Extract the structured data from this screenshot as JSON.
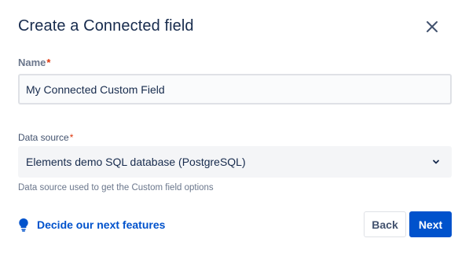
{
  "dialog": {
    "title": "Create a Connected field",
    "close_icon": "close-icon"
  },
  "name_field": {
    "label": "Name",
    "required_mark": "*",
    "value": "My Connected Custom Field"
  },
  "data_source": {
    "label": "Data source",
    "required_mark": "*",
    "selected": "Elements demo SQL database (PostgreSQL)",
    "helper": "Data source used to get the Custom field options",
    "chevron_icon": "chevron-down-icon"
  },
  "footer": {
    "feedback_icon": "lightbulb-icon",
    "feedback_link": "Decide our next features",
    "back_label": "Back",
    "next_label": "Next"
  },
  "colors": {
    "primary": "#0052cc",
    "required": "#de350b",
    "text": "#172b4d"
  }
}
